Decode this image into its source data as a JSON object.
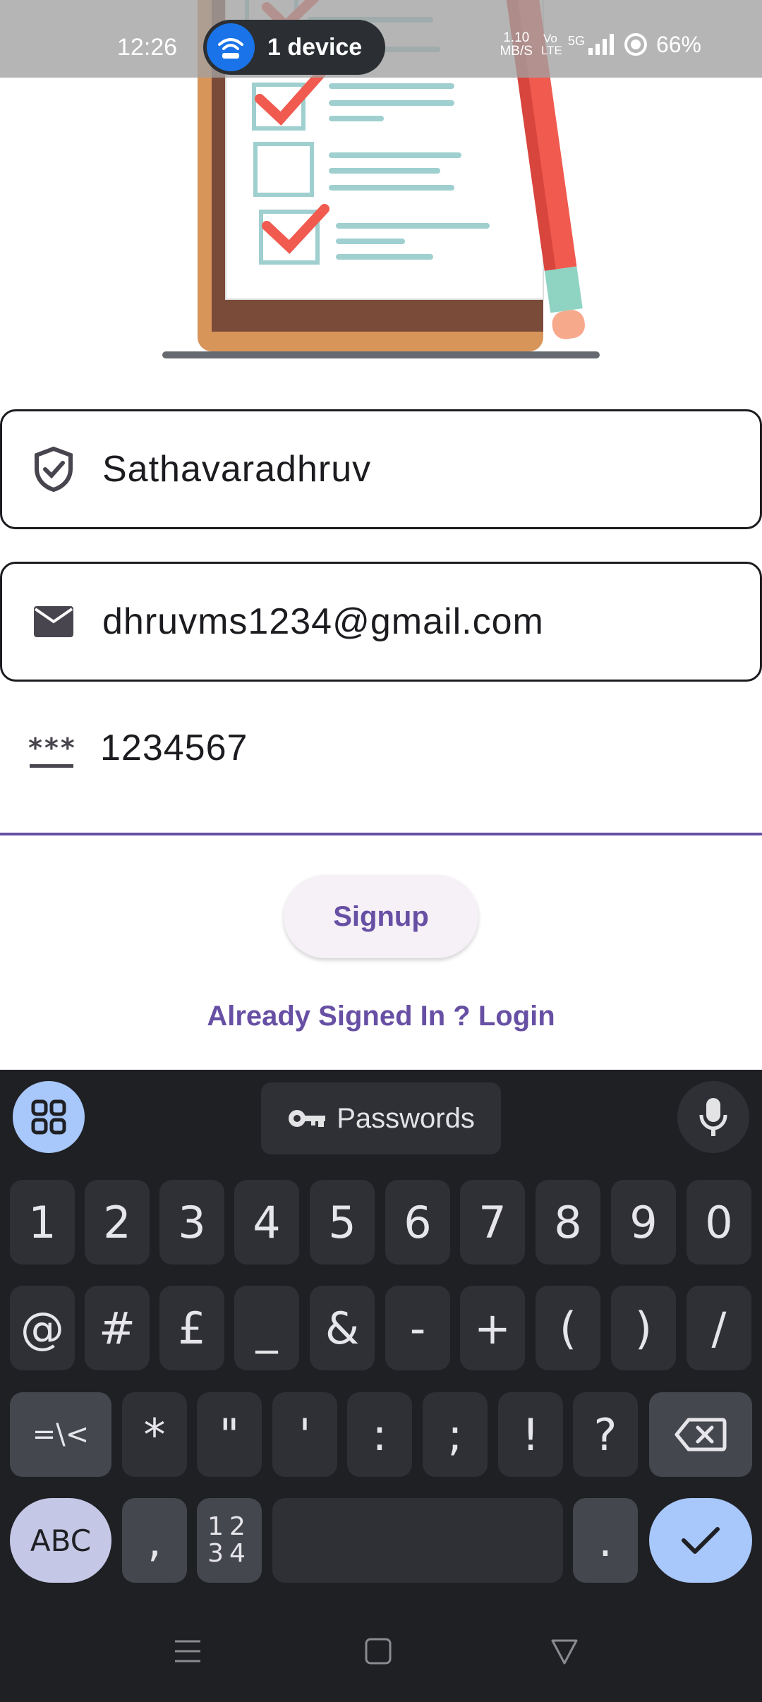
{
  "status_bar": {
    "time": "12:26",
    "hotspot_label": "1 device",
    "net_speed_value": "1.10",
    "net_speed_unit": "MB/S",
    "volte_label": "Vo LTE",
    "network_label": "5G",
    "battery": "66%"
  },
  "form": {
    "username_value": "Sathavaradhruv",
    "email_value": "dhruvms1234@gmail.com",
    "password_value": "1234567",
    "signup_label": "Signup",
    "login_link": "Already Signed In ? Login"
  },
  "keyboard": {
    "passwords_label": "Passwords",
    "row1": [
      "1",
      "2",
      "3",
      "4",
      "5",
      "6",
      "7",
      "8",
      "9",
      "0"
    ],
    "row2": [
      "@",
      "#",
      "£",
      "_",
      "&",
      "-",
      "+",
      "(",
      ")",
      "/"
    ],
    "row3": [
      "*",
      "\"",
      "'",
      ":",
      ";",
      "!",
      "?"
    ],
    "row3_left": "=\\<",
    "abc_label": "ABC",
    "comma_label": ",",
    "numpad_top": "12",
    "numpad_bottom": "34",
    "period_label": "."
  },
  "colors": {
    "accent": "#6750a4",
    "keyboard_bg": "#1f2024",
    "enter_key": "#a8c7fa"
  }
}
